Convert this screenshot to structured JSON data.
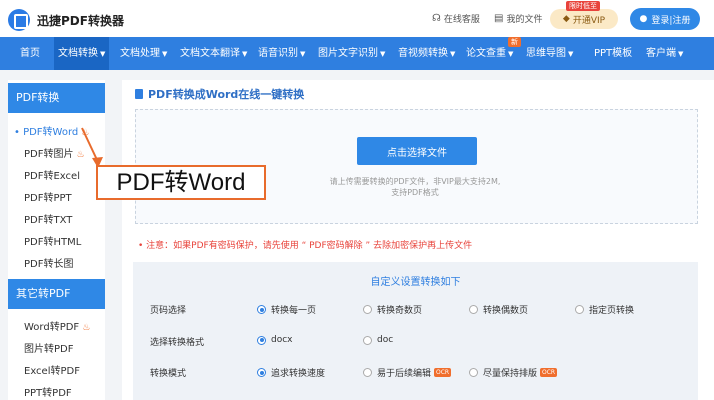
{
  "brand": {
    "name": "迅捷PDF转换器"
  },
  "topbar": {
    "service_label": "在线客服",
    "files_label": "我的文件",
    "vip_label": "开通VIP",
    "vip_badge": "限时低至",
    "login_label": "登录|注册"
  },
  "nav": {
    "items": [
      {
        "label": "首页"
      },
      {
        "label": "文档转换"
      },
      {
        "label": "文档处理"
      },
      {
        "label": "文档文本翻译"
      },
      {
        "label": "语音识别"
      },
      {
        "label": "图片文字识别"
      },
      {
        "label": "音视频转换"
      },
      {
        "label": "论文查重"
      },
      {
        "label": "思维导图"
      },
      {
        "label": "PPT模板"
      },
      {
        "label": "客户端"
      }
    ],
    "new_badge": "新"
  },
  "sidebar": {
    "group1_title": "PDF转换",
    "group1_items": [
      {
        "label": "PDF转Word"
      },
      {
        "label": "PDF转图片"
      },
      {
        "label": "PDF转Excel"
      },
      {
        "label": "PDF转PPT"
      },
      {
        "label": "PDF转TXT"
      },
      {
        "label": "PDF转HTML"
      },
      {
        "label": "PDF转长图"
      }
    ],
    "group2_title": "其它转PDF",
    "group2_items": [
      {
        "label": "Word转PDF"
      },
      {
        "label": "图片转PDF"
      },
      {
        "label": "Excel转PDF"
      },
      {
        "label": "PPT转PDF"
      }
    ]
  },
  "callout": {
    "text": "PDF转Word"
  },
  "main": {
    "title": "PDF转换成Word在线一键转换",
    "upload_label": "点击选择文件",
    "hint1": "请上传需要转换的PDF文件，非VIP最大支持2M,",
    "hint2": "支持PDF格式",
    "notice_prefix": "• 注意：如果PDF有密码保护，请先使用",
    "notice_link": "“ PDF密码解除 ”",
    "notice_suffix": "去除加密保护再上传文件"
  },
  "settings": {
    "title": "自定义设置转换如下",
    "page_label": "页码选择",
    "page_options": [
      "转换每一页",
      "转换奇数页",
      "转换偶数页",
      "指定页转换"
    ],
    "format_label": "选择转换格式",
    "format_options": [
      "docx",
      "doc"
    ],
    "mode_label": "转换模式",
    "mode_options": [
      "追求转换速度",
      "易于后续编辑",
      "尽量保持排版"
    ],
    "ocr_badge": "OCR"
  }
}
